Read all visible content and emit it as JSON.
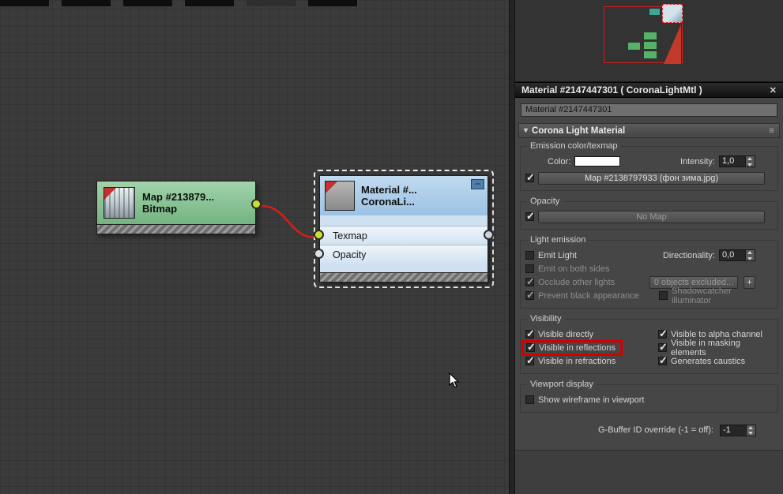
{
  "editor": {
    "nodes": {
      "bitmap": {
        "title": "Map  #213879...",
        "subtitle": "Bitmap"
      },
      "material": {
        "title": "Material  #...",
        "subtitle": "CoronaLi...",
        "minimize_icon": "−",
        "slot_texmap": "Texmap",
        "slot_opacity": "Opacity"
      }
    }
  },
  "panel": {
    "title": "Material #2147447301  ( CoronaLightMtl )",
    "close_icon": "✕",
    "name_field": "Material #2147447301",
    "rollout_title": "Corona Light Material",
    "rollout_arrow": "▾",
    "rollout_menu_icon": "≡",
    "emission": {
      "label": "Emission color/texmap",
      "color_label": "Color:",
      "intensity_label": "Intensity:",
      "intensity_value": "1,0",
      "map_checked": true,
      "map_button": "Map #2138797933 (фон зима.jpg)"
    },
    "opacity": {
      "label": "Opacity",
      "checked": true,
      "map_button": "No Map"
    },
    "light": {
      "label": "Light emission",
      "emit_light_label": "Emit Light",
      "emit_light_checked": false,
      "directionality_label": "Directionality:",
      "directionality_value": "0,0",
      "emit_both_label": "Emit on both sides",
      "emit_both_checked": false,
      "occlude_label": "Occlude other lights",
      "occlude_checked": true,
      "exclude_button": "0 objects excluded...",
      "exclude_plus": "+",
      "prevent_label": "Prevent black appearance",
      "prevent_checked": true,
      "shadow_label": "Shadowcatcher illuminator",
      "shadow_checked": false
    },
    "visibility": {
      "label": "Visibility",
      "directly_label": "Visible directly",
      "directly_checked": true,
      "reflections_label": "Visible in reflections",
      "reflections_checked": true,
      "refractions_label": "Visible in refractions",
      "refractions_checked": true,
      "alpha_label": "Visible to alpha channel",
      "alpha_checked": true,
      "masking_label": "Visible in masking elements",
      "masking_checked": true,
      "caustics_label": "Generates caustics",
      "caustics_checked": true
    },
    "viewport": {
      "label": "Viewport display",
      "wireframe_label": "Show wireframe in viewport",
      "wireframe_checked": false
    },
    "gbuffer": {
      "label": "G-Buffer ID override (-1 = off):",
      "value": "-1"
    }
  }
}
